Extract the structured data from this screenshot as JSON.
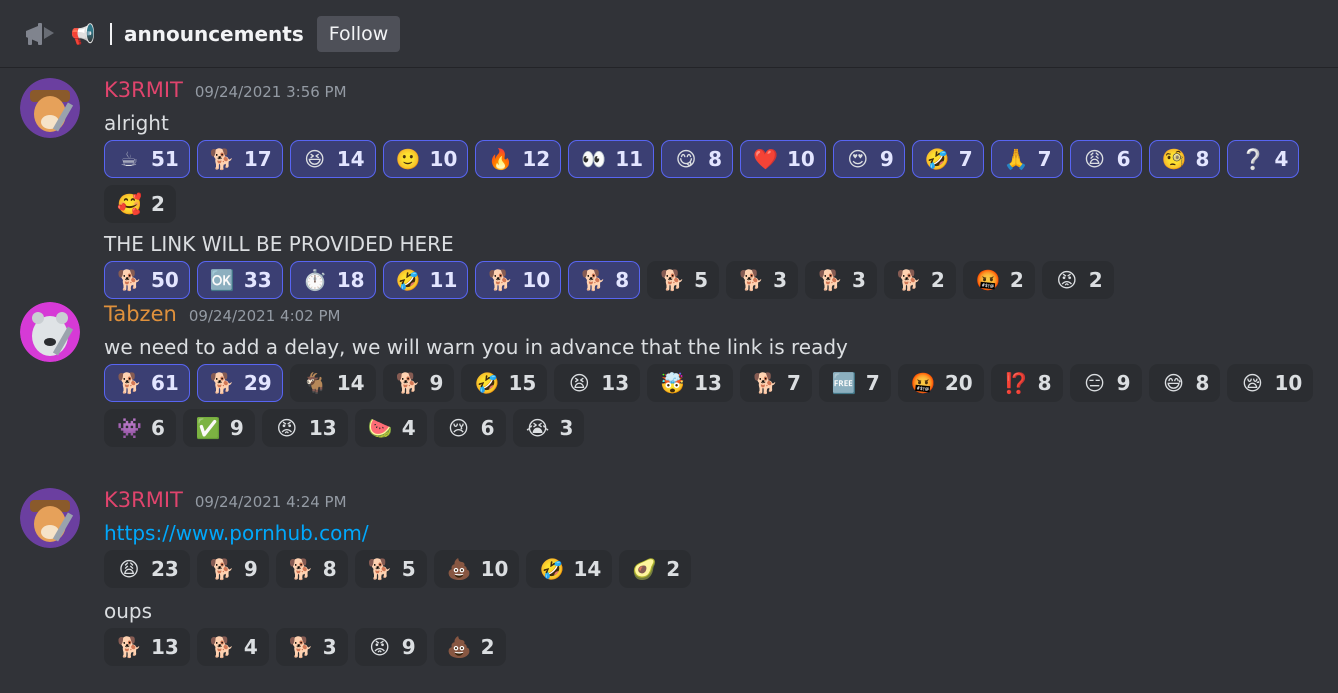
{
  "header": {
    "channel_icon": "announcement-channel-icon",
    "megaphone": "📢",
    "channel_name": "announcements",
    "follow_label": "Follow"
  },
  "messages": [
    {
      "author": "K3RMIT",
      "author_color": "#e0446d",
      "timestamp": "09/24/2021 3:56 PM",
      "avatar": "shiba-dog-avatar",
      "blocks": [
        {
          "text": "alright",
          "reactions": [
            {
              "emoji": "☕",
              "count": "51",
              "me": true
            },
            {
              "emoji": "🐕",
              "count": "17",
              "me": true
            },
            {
              "emoji": "😆",
              "count": "14",
              "me": true
            },
            {
              "emoji": "🙂",
              "count": "10",
              "me": true
            },
            {
              "emoji": "🔥",
              "count": "12",
              "me": true
            },
            {
              "emoji": "👀",
              "count": "11",
              "me": true
            },
            {
              "emoji": "😋",
              "count": "8",
              "me": true
            },
            {
              "emoji": "❤️",
              "count": "10",
              "me": true
            },
            {
              "emoji": "😍",
              "count": "9",
              "me": true
            },
            {
              "emoji": "🤣",
              "count": "7",
              "me": true
            },
            {
              "emoji": "🙏",
              "count": "7",
              "me": true
            },
            {
              "emoji": "😩",
              "count": "6",
              "me": true
            },
            {
              "emoji": "🧐",
              "count": "8",
              "me": true
            },
            {
              "emoji": "❔",
              "count": "4",
              "me": true
            },
            {
              "emoji": "🥰",
              "count": "2",
              "me": false
            }
          ]
        },
        {
          "text": "THE LINK WILL BE PROVIDED HERE",
          "reactions": [
            {
              "emoji": "🐕",
              "count": "50",
              "me": true
            },
            {
              "emoji": "🆗",
              "count": "33",
              "me": true
            },
            {
              "emoji": "⏱️",
              "count": "18",
              "me": true
            },
            {
              "emoji": "🤣",
              "count": "11",
              "me": true
            },
            {
              "emoji": "🐕",
              "count": "10",
              "me": true
            },
            {
              "emoji": "🐕",
              "count": "8",
              "me": true
            },
            {
              "emoji": "🐕",
              "count": "5",
              "me": false
            },
            {
              "emoji": "🐕",
              "count": "3",
              "me": false
            },
            {
              "emoji": "🐕",
              "count": "3",
              "me": false
            },
            {
              "emoji": "🐕",
              "count": "2",
              "me": false
            },
            {
              "emoji": "🤬",
              "count": "2",
              "me": false
            },
            {
              "emoji": "😡",
              "count": "2",
              "me": false
            }
          ]
        }
      ]
    },
    {
      "author": "Tabzen",
      "author_color": "#e0913c",
      "timestamp": "09/24/2021 4:02 PM",
      "avatar": "polar-bear-avatar",
      "blocks": [
        {
          "text": "we need to add a delay, we will warn you in advance that the link is ready",
          "reactions": [
            {
              "emoji": "🐕",
              "count": "61",
              "me": true
            },
            {
              "emoji": "🐕",
              "count": "29",
              "me": true
            },
            {
              "emoji": "🐐",
              "count": "14",
              "me": false
            },
            {
              "emoji": "🐕",
              "count": "9",
              "me": false
            },
            {
              "emoji": "🤣",
              "count": "15",
              "me": false
            },
            {
              "emoji": "😫",
              "count": "13",
              "me": false
            },
            {
              "emoji": "🤯",
              "count": "13",
              "me": false
            },
            {
              "emoji": "🐕",
              "count": "7",
              "me": false
            },
            {
              "emoji": "🆓",
              "count": "7",
              "me": false
            },
            {
              "emoji": "🤬",
              "count": "20",
              "me": false
            },
            {
              "emoji": "⁉️",
              "count": "8",
              "me": false
            },
            {
              "emoji": "😑",
              "count": "9",
              "me": false
            },
            {
              "emoji": "😅",
              "count": "8",
              "me": false
            },
            {
              "emoji": "😪",
              "count": "10",
              "me": false
            },
            {
              "emoji": "👾",
              "count": "6",
              "me": false
            },
            {
              "emoji": "✅",
              "count": "9",
              "me": false
            },
            {
              "emoji": "😡",
              "count": "13",
              "me": false
            },
            {
              "emoji": "🍉",
              "count": "4",
              "me": false
            },
            {
              "emoji": "😢",
              "count": "6",
              "me": false
            },
            {
              "emoji": "😭",
              "count": "3",
              "me": false
            }
          ]
        }
      ]
    },
    {
      "author": "K3RMIT",
      "author_color": "#e0446d",
      "timestamp": "09/24/2021 4:24 PM",
      "avatar": "shiba-dog-avatar",
      "blocks": [
        {
          "link": "https://www.pornhub.com/",
          "reactions": [
            {
              "emoji": "😩",
              "count": "23",
              "me": false
            },
            {
              "emoji": "🐕",
              "count": "9",
              "me": false
            },
            {
              "emoji": "🐕",
              "count": "8",
              "me": false
            },
            {
              "emoji": "🐕",
              "count": "5",
              "me": false
            },
            {
              "emoji": "💩",
              "count": "10",
              "me": false
            },
            {
              "emoji": "🤣",
              "count": "14",
              "me": false
            },
            {
              "emoji": "🥑",
              "count": "2",
              "me": false
            }
          ]
        },
        {
          "text": "oups",
          "reactions": [
            {
              "emoji": "🐕",
              "count": "13",
              "me": false
            },
            {
              "emoji": "🐕",
              "count": "4",
              "me": false
            },
            {
              "emoji": "🐕",
              "count": "3",
              "me": false
            },
            {
              "emoji": "😡",
              "count": "9",
              "me": false
            },
            {
              "emoji": "💩",
              "count": "2",
              "me": false
            }
          ]
        }
      ]
    }
  ]
}
